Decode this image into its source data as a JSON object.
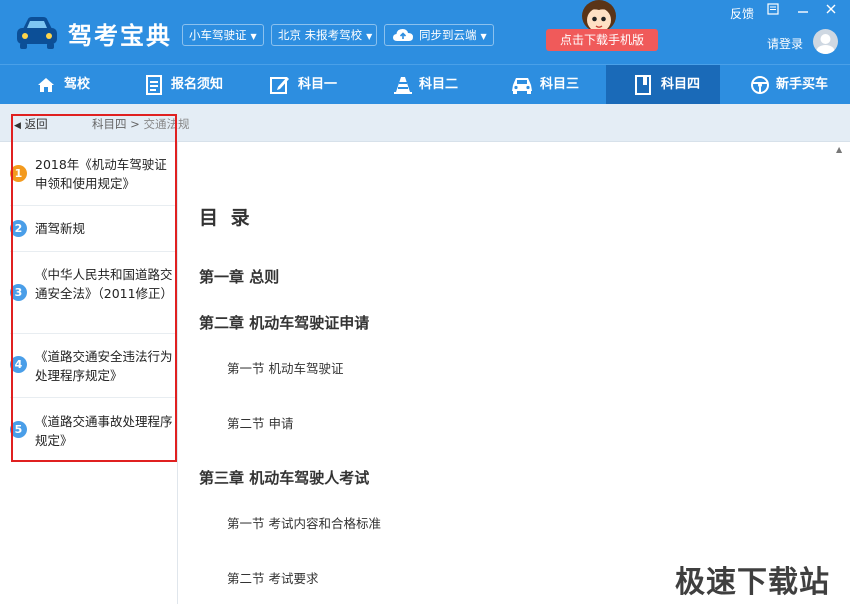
{
  "app": {
    "title": "驾考宝典",
    "license_dropdown": "小车驾驶证",
    "city_dropdown": "北京 未报考驾校",
    "sync_dropdown": "同步到云端",
    "download_button": "点击下载手机版",
    "feedback": "反馈",
    "login": "请登录"
  },
  "nav": {
    "items": [
      {
        "label": "驾校",
        "icon": "home-icon"
      },
      {
        "label": "报名须知",
        "icon": "document-icon"
      },
      {
        "label": "科目一",
        "icon": "edit-icon"
      },
      {
        "label": "科目二",
        "icon": "cone-icon"
      },
      {
        "label": "科目三",
        "icon": "car-icon"
      },
      {
        "label": "科目四",
        "icon": "book-icon"
      },
      {
        "label": "新手买车",
        "icon": "steering-wheel-icon"
      }
    ],
    "active": "科目四"
  },
  "breadcrumb": {
    "back": "返回",
    "root": "科目四",
    "separator": ">",
    "current": "交通法规"
  },
  "sidebar": {
    "items": [
      {
        "num": "1",
        "label": "2018年《机动车驾驶证申领和使用规定》"
      },
      {
        "num": "2",
        "label": "酒驾新规"
      },
      {
        "num": "3",
        "label": "《中华人民共和国道路交通安全法》（2011修正）"
      },
      {
        "num": "4",
        "label": "《道路交通安全违法行为处理程序规定》"
      },
      {
        "num": "5",
        "label": "《道路交通事故处理程序规定》"
      }
    ]
  },
  "content": {
    "title": "目 录",
    "chapters": [
      {
        "title": "第一章 总则",
        "sections": []
      },
      {
        "title": "第二章 机动车驾驶证申请",
        "sections": [
          "第一节 机动车驾驶证",
          "第二节 申请"
        ]
      },
      {
        "title": "第三章 机动车驾驶人考试",
        "sections": [
          "第一节 考试内容和合格标准",
          "第二节 考试要求"
        ]
      }
    ]
  },
  "watermark": "极速下载站",
  "colors": {
    "primary": "#2d8ee0",
    "nav_active": "#1a6ab8",
    "download_button": "#f05a5a",
    "highlight_box": "#e02020",
    "badge_first": "#f39a1e",
    "badge": "#4a9ee8"
  }
}
